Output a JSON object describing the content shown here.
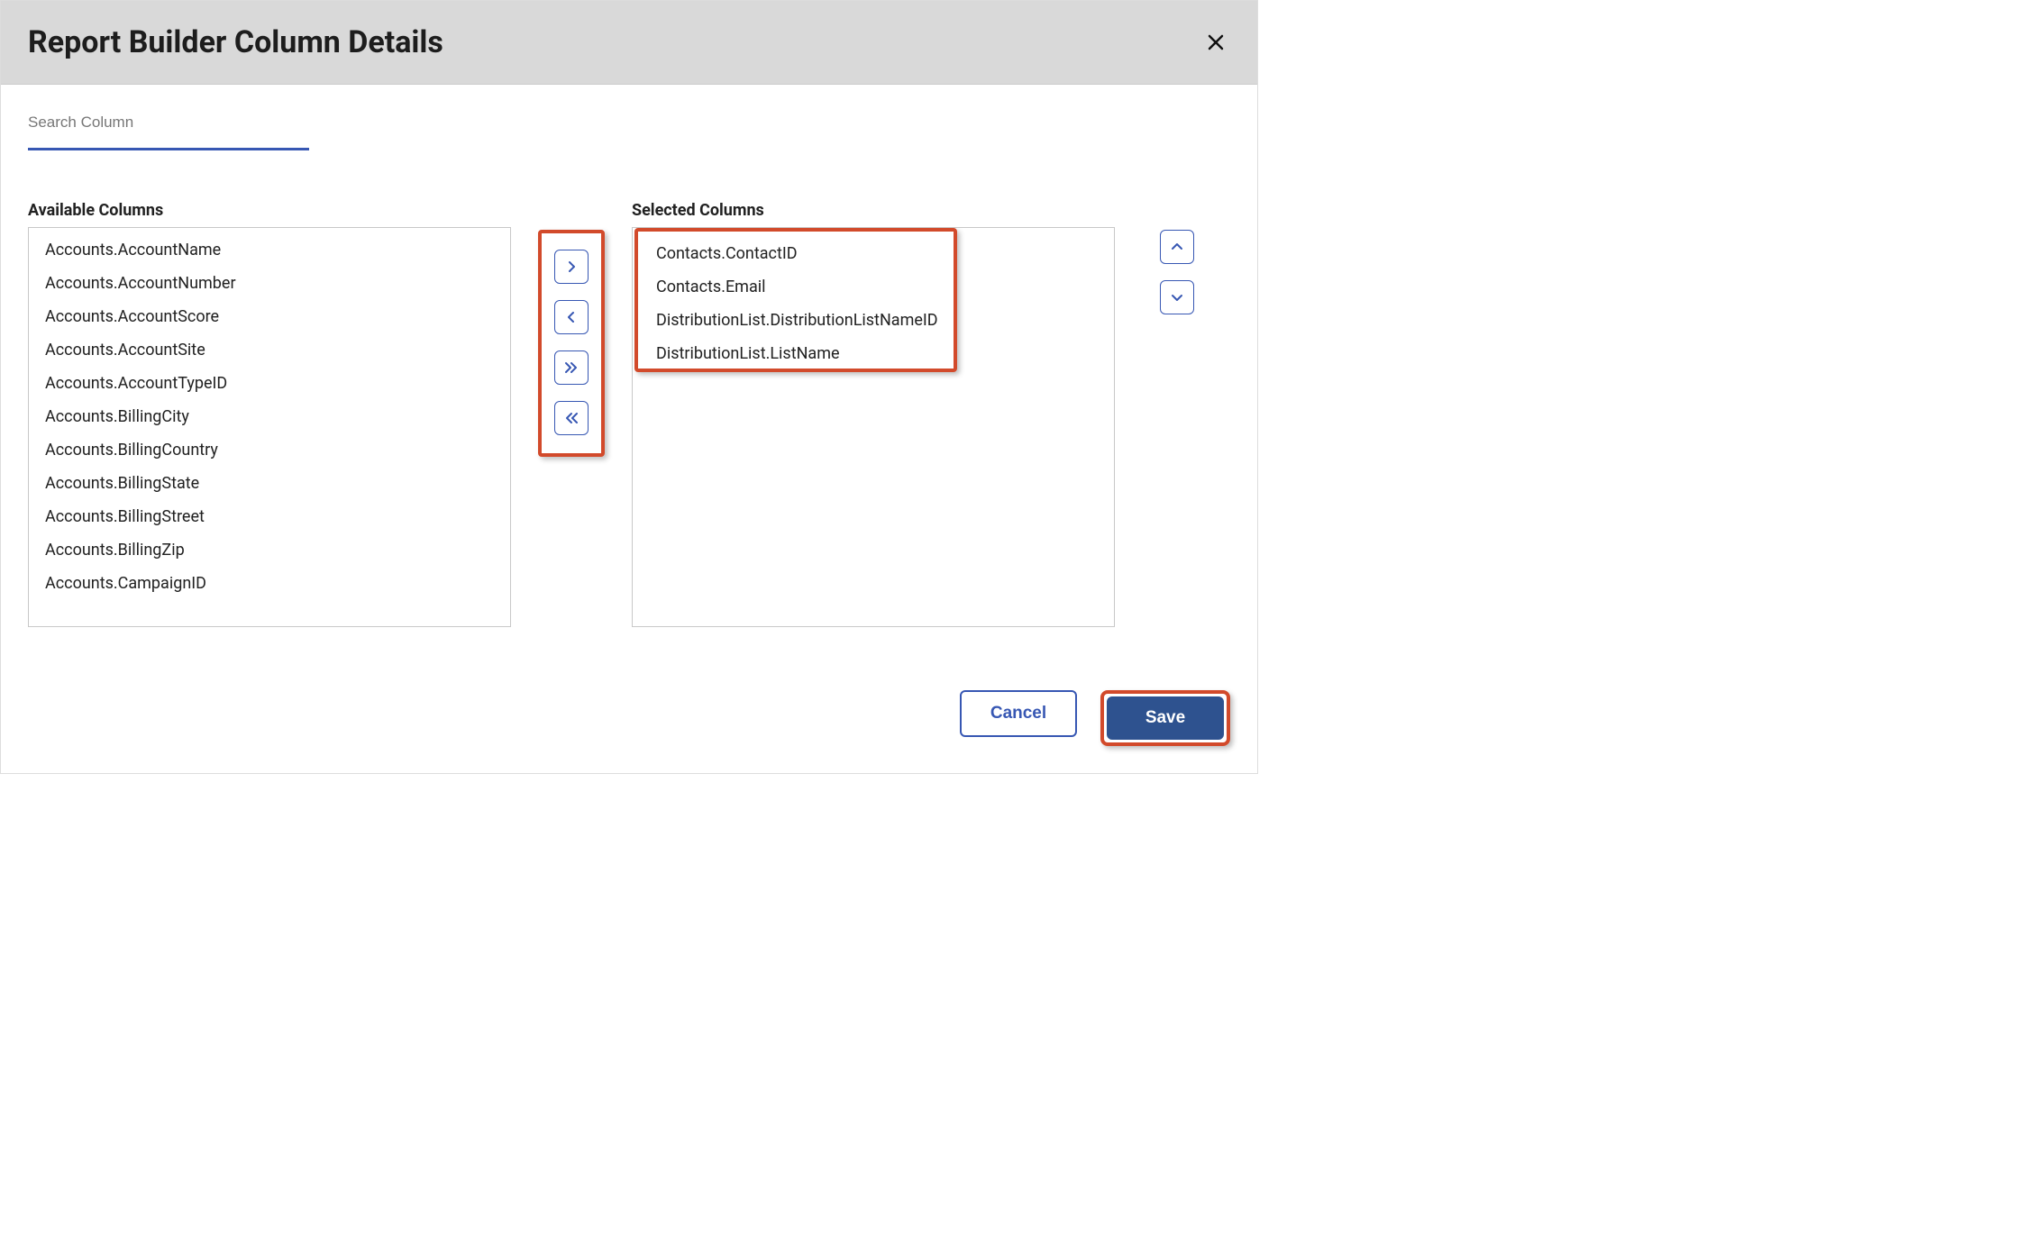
{
  "dialog": {
    "title": "Report Builder Column Details"
  },
  "search": {
    "placeholder": "Search Column",
    "value": ""
  },
  "labels": {
    "available": "Available Columns",
    "selected": "Selected Columns"
  },
  "available_columns": [
    "Accounts.AccountName",
    "Accounts.AccountNumber",
    "Accounts.AccountScore",
    "Accounts.AccountSite",
    "Accounts.AccountTypeID",
    "Accounts.BillingCity",
    "Accounts.BillingCountry",
    "Accounts.BillingState",
    "Accounts.BillingStreet",
    "Accounts.BillingZip",
    "Accounts.CampaignID"
  ],
  "selected_columns": [
    "Contacts.ContactID",
    "Contacts.Email",
    "DistributionList.DistributionListNameID",
    "DistributionList.ListName"
  ],
  "footer": {
    "cancel": "Cancel",
    "save": "Save"
  }
}
